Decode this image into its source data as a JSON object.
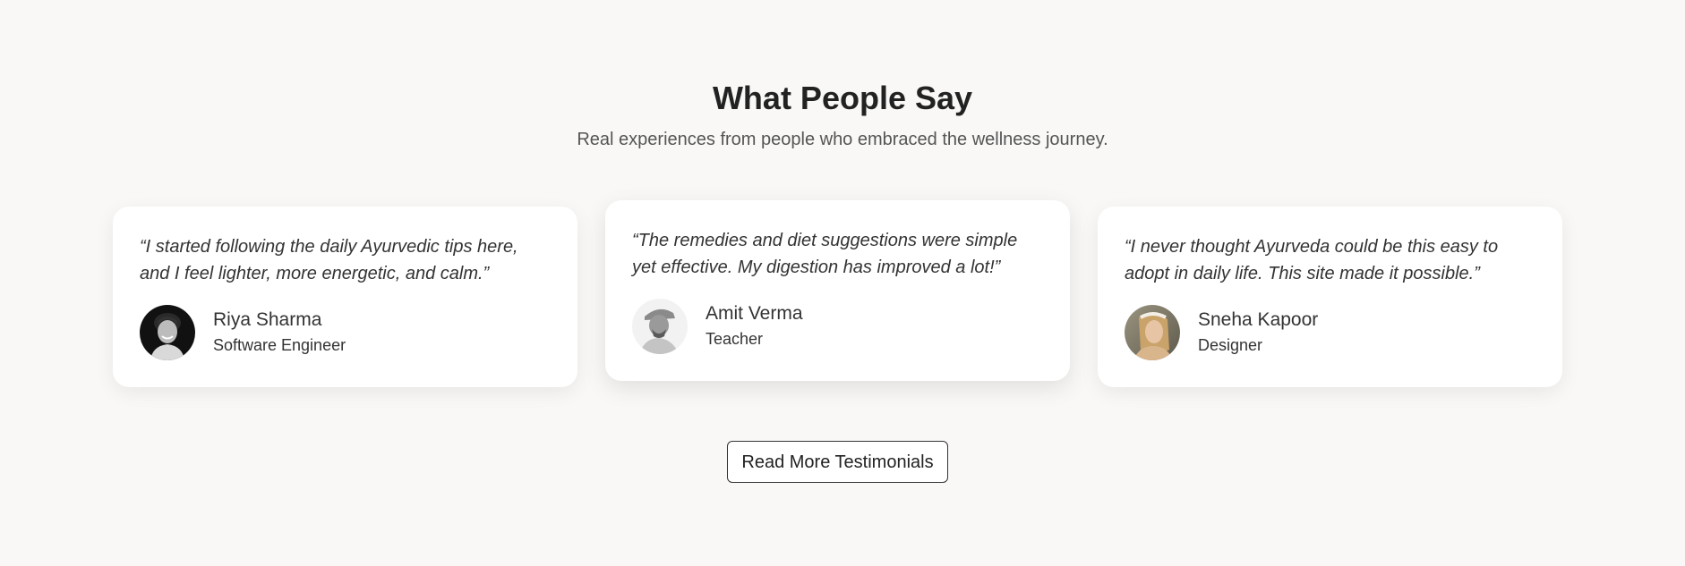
{
  "section": {
    "title": "What People Say",
    "subtitle": "Real experiences from people who embraced the wellness journey."
  },
  "testimonials": [
    {
      "quote": "“I started following the daily Ayurvedic tips here, and I feel lighter, more energetic, and calm.”",
      "name": "Riya Sharma",
      "role": "Software Engineer",
      "avatar_icon": "person-photo-riya"
    },
    {
      "quote": "“The remedies and diet suggestions were simple yet effective. My digestion has improved a lot!”",
      "name": "Amit Verma",
      "role": "Teacher",
      "avatar_icon": "person-photo-amit"
    },
    {
      "quote": "“I never thought Ayurveda could be this easy to adopt in daily life. This site made it possible.”",
      "name": "Sneha Kapoor",
      "role": "Designer",
      "avatar_icon": "person-photo-sneha"
    }
  ],
  "cta": {
    "label": "Read More Testimonials"
  },
  "colors": {
    "background": "#f9f8f6",
    "card": "#ffffff",
    "text": "#222222",
    "muted": "#555555"
  }
}
